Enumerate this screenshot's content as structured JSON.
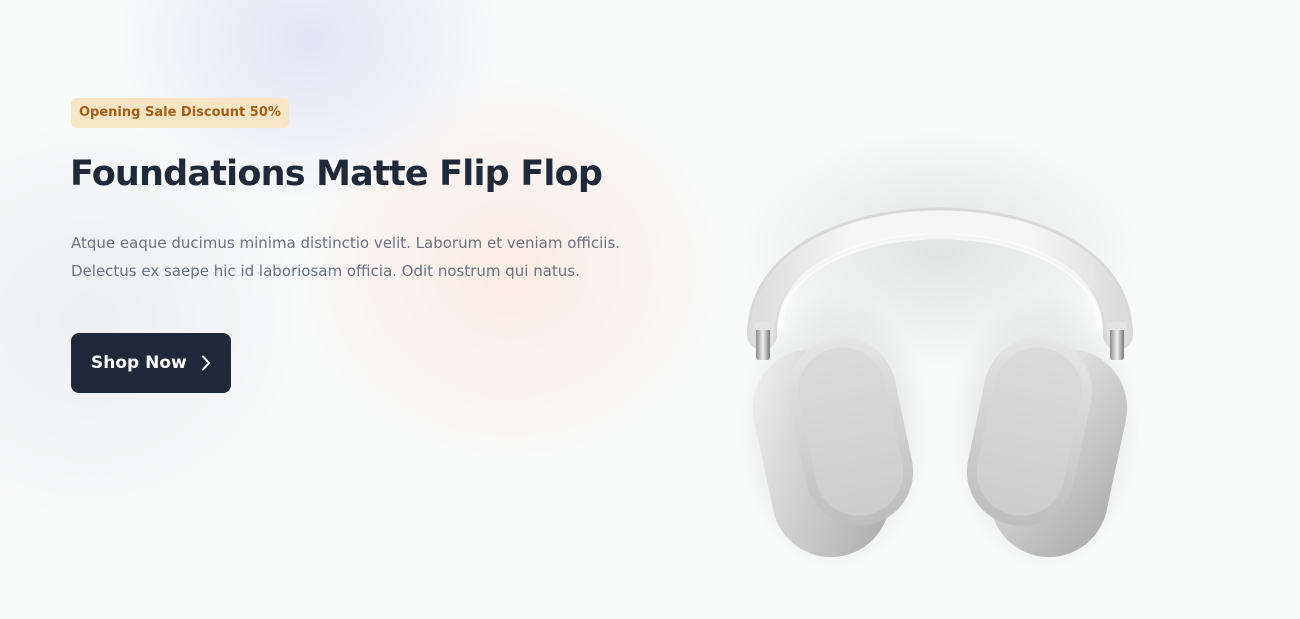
{
  "hero": {
    "badge": "Opening Sale Discount 50%",
    "title": "Foundations Matte Flip Flop",
    "description": "Atque eaque ducimus minima distinctio velit. Laborum et veniam officiis. Delectus ex saepe hic id laboriosam officia. Odit nostrum qui natus.",
    "cta_label": "Shop Now",
    "cta_icon": "chevron-right-icon",
    "product_image": "headphones-image"
  },
  "colors": {
    "badge_bg": "#f7e5c6",
    "badge_text": "#a45f17",
    "title": "#1f2937",
    "body_text": "#6b7280",
    "button_bg": "#1f2937",
    "button_text": "#ffffff"
  }
}
